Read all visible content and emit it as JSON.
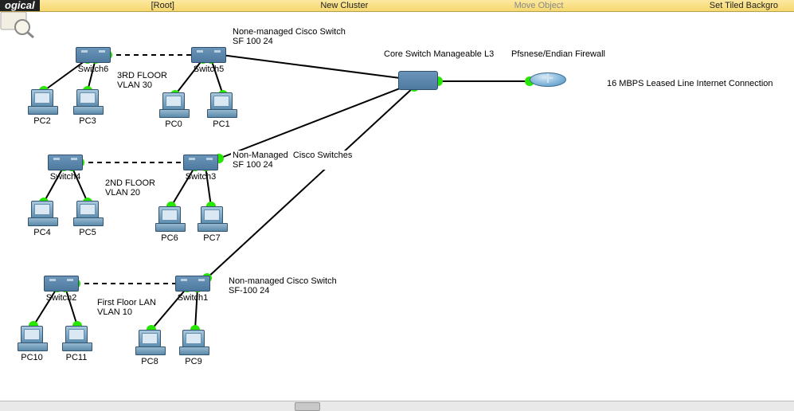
{
  "toolbar": {
    "logical": "ogical",
    "root": "[Root]",
    "newCluster": "New Cluster",
    "moveObject": "Move Object",
    "setTiled": "Set Tiled Backgro"
  },
  "annotations": {
    "noneManagedSwitchTop": "None-managed Cisco Switch\nSF 100 24",
    "coreSwitch": "Core Switch Manageable L3",
    "firewall": "Pfsnese/Endian Firewall",
    "leasedLine": "16 MBPS Leased Line Internet Connection",
    "floor3": "3RD FLOOR\nVLAN 30",
    "nonManagedSwitches": "Non-Managed  Cisco Switches\nSF 100 24",
    "floor2": "2ND FLOOR\nVLAN 20",
    "nonManagedSwitchBottom": "Non-managed Cisco Switch\nSF-100 24",
    "floor1": "First Floor LAN\nVLAN 10"
  },
  "devices": {
    "switch6": "Switch6",
    "switch5": "Switch5",
    "switch4": "Switch4",
    "switch3": "Switch3",
    "switch2": "Switch2",
    "switch1": "Switch1",
    "pc0": "PC0",
    "pc1": "PC1",
    "pc2": "PC2",
    "pc3": "PC3",
    "pc4": "PC4",
    "pc5": "PC5",
    "pc6": "PC6",
    "pc7": "PC7",
    "pc8": "PC8",
    "pc9": "PC9",
    "pc10": "PC10",
    "pc11": "PC11"
  },
  "link_colors": {
    "up": "#27e600"
  }
}
